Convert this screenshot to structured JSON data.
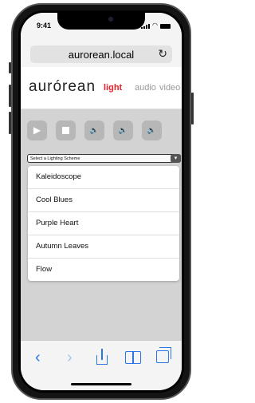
{
  "status_bar": {
    "time": "9:41"
  },
  "browser": {
    "url": "aurorean.local",
    "reload_glyph": "↻"
  },
  "site": {
    "logo": "aurórean",
    "nav": [
      {
        "label": "light",
        "active": true,
        "color": "#e8202c"
      },
      {
        "label": "audio",
        "active": false
      },
      {
        "label": "video",
        "active": false
      }
    ]
  },
  "controls": [
    {
      "icon": "play-icon",
      "glyph": "▶"
    },
    {
      "icon": "stop-icon",
      "glyph": ""
    },
    {
      "icon": "volume-low-icon",
      "glyph": "🔈"
    },
    {
      "icon": "volume-high-icon",
      "glyph": "🔊"
    },
    {
      "icon": "volume-mute-icon",
      "glyph": "🔈"
    }
  ],
  "lighting": {
    "select_label": "Select a Lighting Scheme",
    "options": [
      "Kaleidoscope",
      "Cool Blues",
      "Purple Heart",
      "Autumn Leaves",
      "Flow"
    ]
  },
  "toolbar": {
    "back": "‹",
    "forward": "›"
  },
  "colors": {
    "accent": "#e8202c",
    "ios_blue": "#2a76e8"
  }
}
